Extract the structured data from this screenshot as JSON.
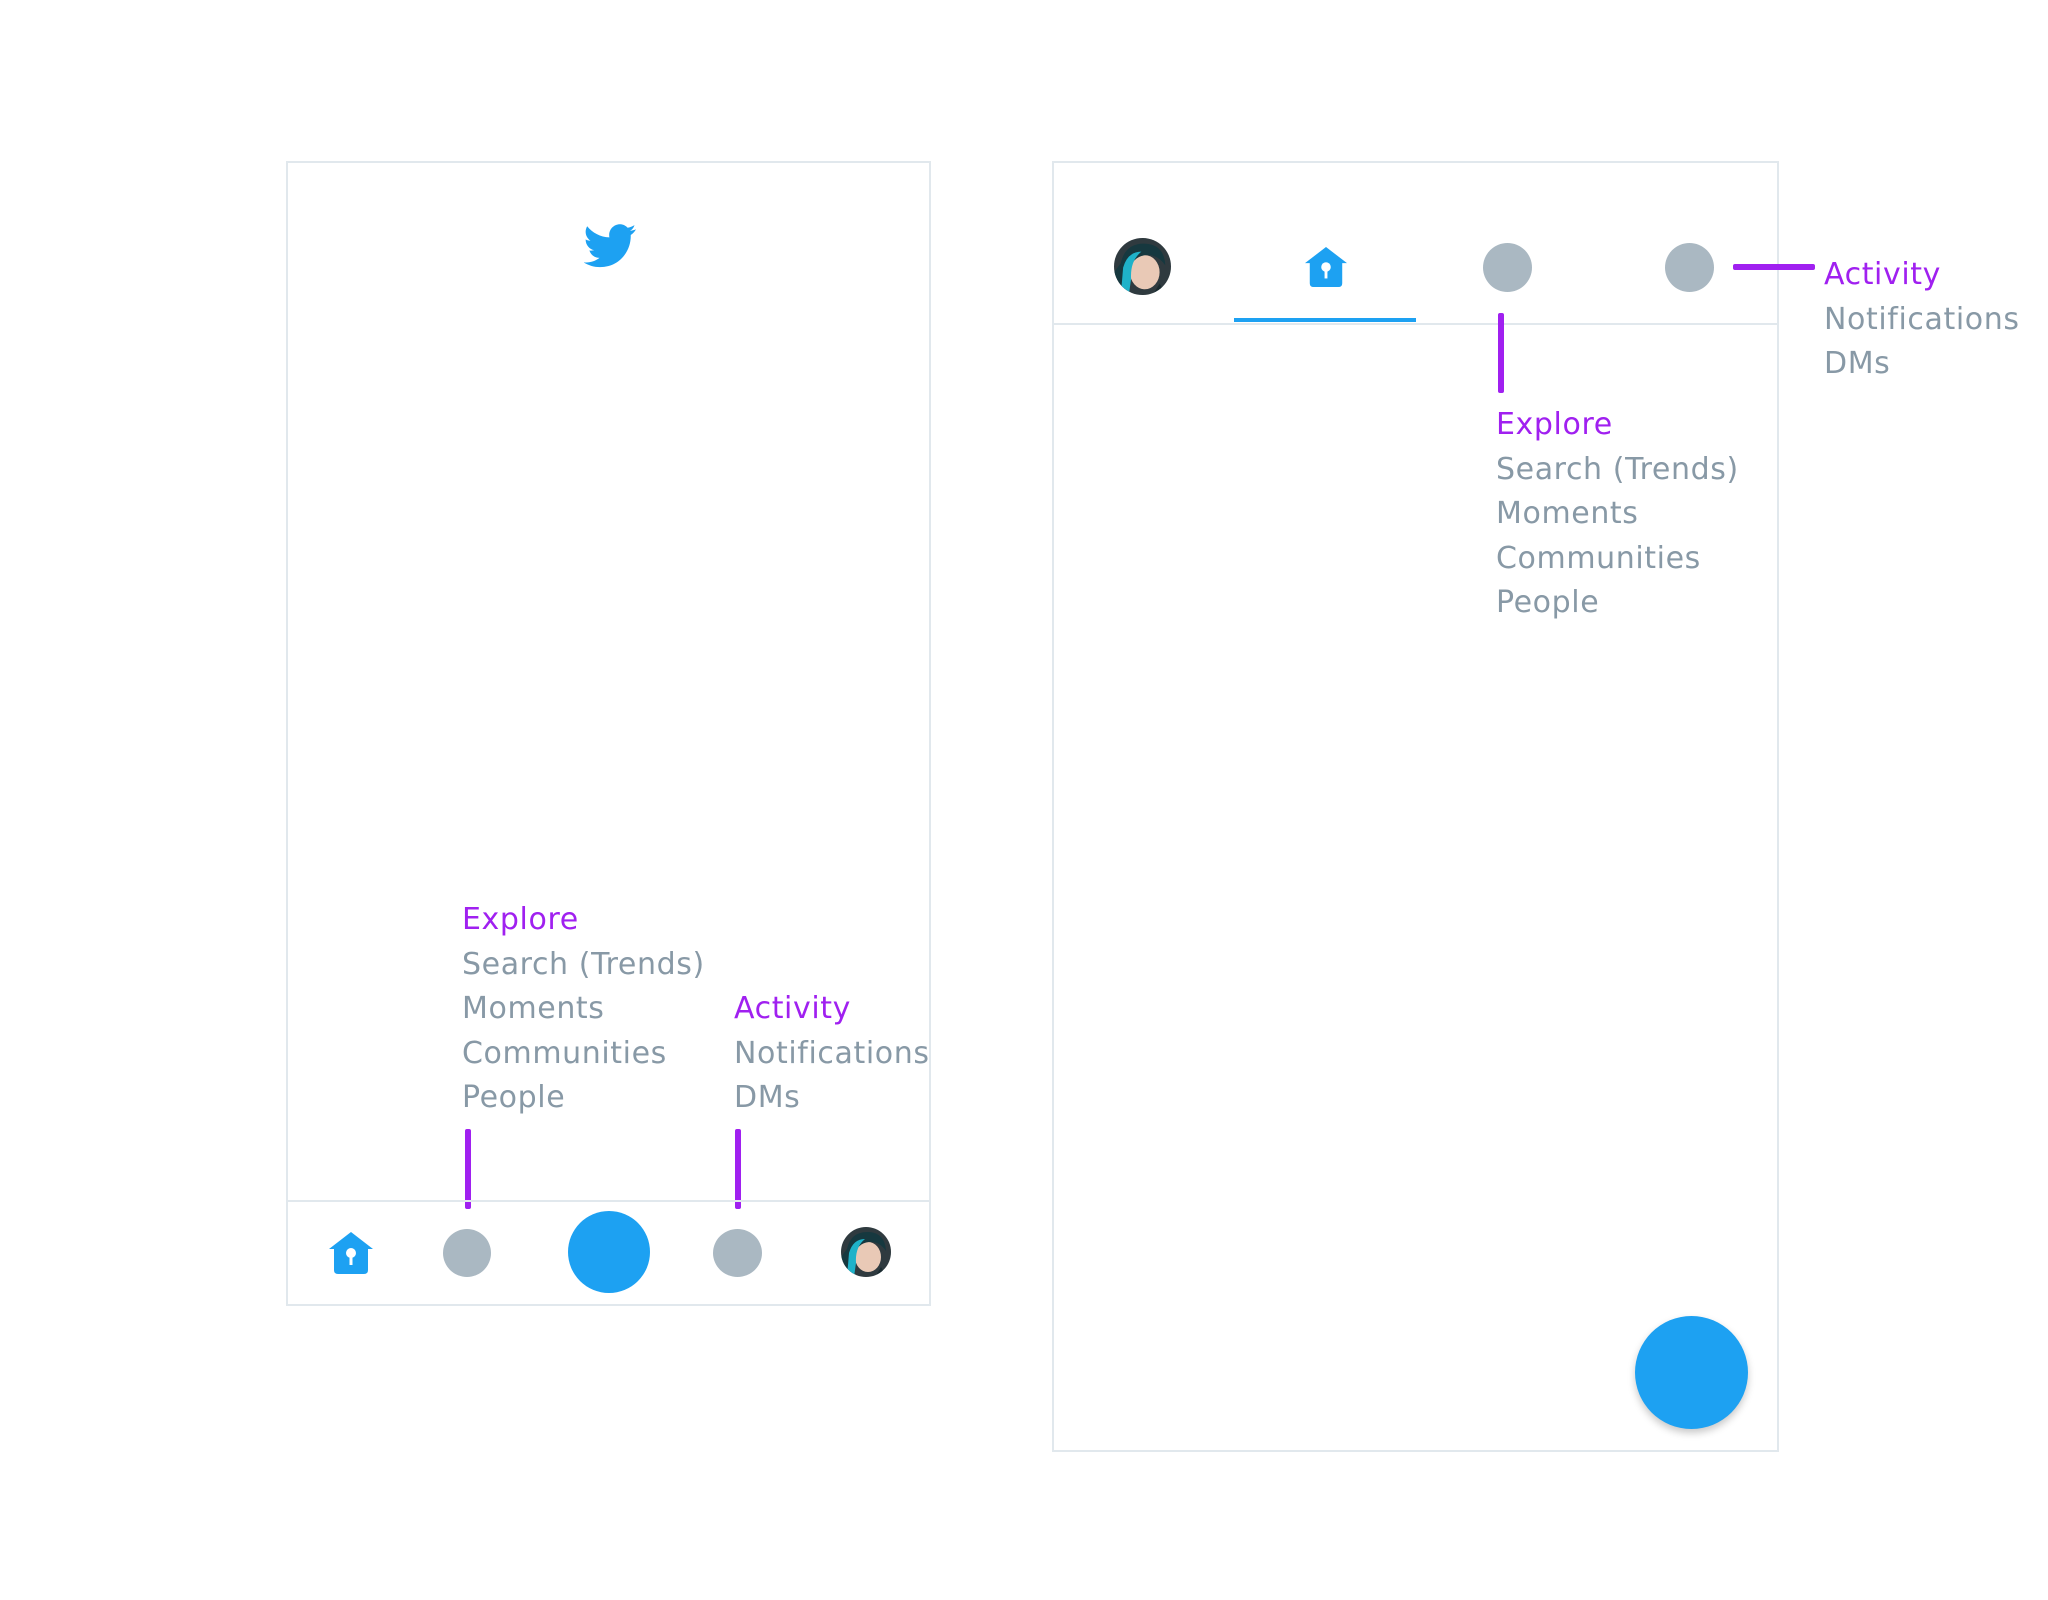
{
  "colors": {
    "brand": "#1da1f2",
    "annotation": "#a020f0",
    "muted_text": "#8899a6",
    "placeholder_icon": "#aab8c2",
    "border": "#e1e8ed"
  },
  "icons": {
    "header_logo": "twitter-bird-icon",
    "home": "birdhouse-home-icon",
    "placeholder": "placeholder-circle-icon",
    "compose": "compose-fab",
    "profile": "profile-avatar"
  },
  "ios": {
    "explore": {
      "heading": "Explore",
      "items": [
        "Search (Trends)",
        "Moments",
        "Communities",
        "People"
      ]
    },
    "activity": {
      "heading": "Activity",
      "items": [
        "Notifications",
        "DMs"
      ]
    }
  },
  "android": {
    "explore": {
      "heading": "Explore",
      "items": [
        "Search (Trends)",
        "Moments",
        "Communities",
        "People"
      ]
    },
    "activity": {
      "heading": "Activity",
      "items": [
        "Notifications",
        "DMs"
      ]
    }
  }
}
